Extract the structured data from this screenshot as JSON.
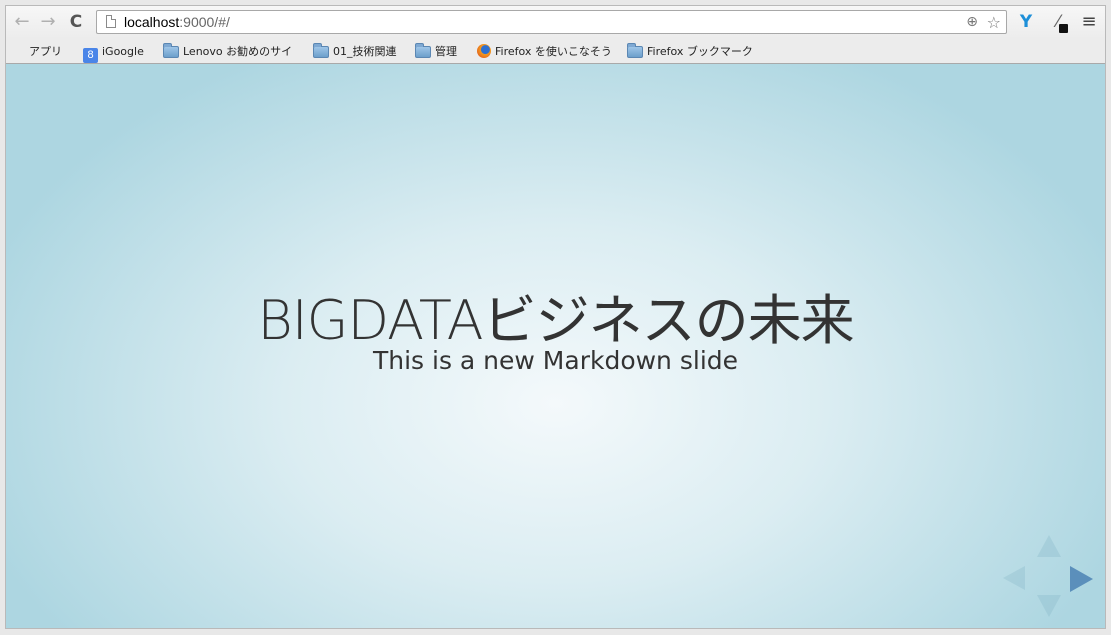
{
  "browser": {
    "url_host": "localhost",
    "url_rest": ":9000/#/",
    "nav": {
      "back_glyph": "←",
      "forward_glyph": "→",
      "reload_glyph": "C"
    },
    "icons": {
      "zoom": "zoom-icon",
      "star": "bookmark-star-icon",
      "extension_v": "vysor-extension-icon",
      "eyedropper": "eyedropper-extension-icon",
      "menu": "hamburger-menu-icon"
    },
    "accent_colors": {
      "extension_v": "#1d8fd8"
    }
  },
  "bookmarks": [
    {
      "label": "アプリ",
      "icon": "apps-grid-icon"
    },
    {
      "label": "iGoogle",
      "icon": "google-icon"
    },
    {
      "label": "Lenovo お勧めのサイ",
      "icon": "folder-icon"
    },
    {
      "label": "01_技術関連",
      "icon": "folder-icon"
    },
    {
      "label": "管理",
      "icon": "folder-icon"
    },
    {
      "label": "Firefox を使いこなそう",
      "icon": "firefox-icon"
    },
    {
      "label": "Firefox ブックマーク",
      "icon": "folder-icon"
    }
  ],
  "slide": {
    "title": "BIGDATAビジネスの未来",
    "subtitle": "This is a new Markdown slide",
    "text_color": "#333333",
    "background_center": "#f4f9fb",
    "background_edge": "#add6e1",
    "controls": {
      "active_color": "#5b8fbb",
      "up_enabled": false,
      "down_enabled": false,
      "left_enabled": false,
      "right_enabled": true
    }
  }
}
